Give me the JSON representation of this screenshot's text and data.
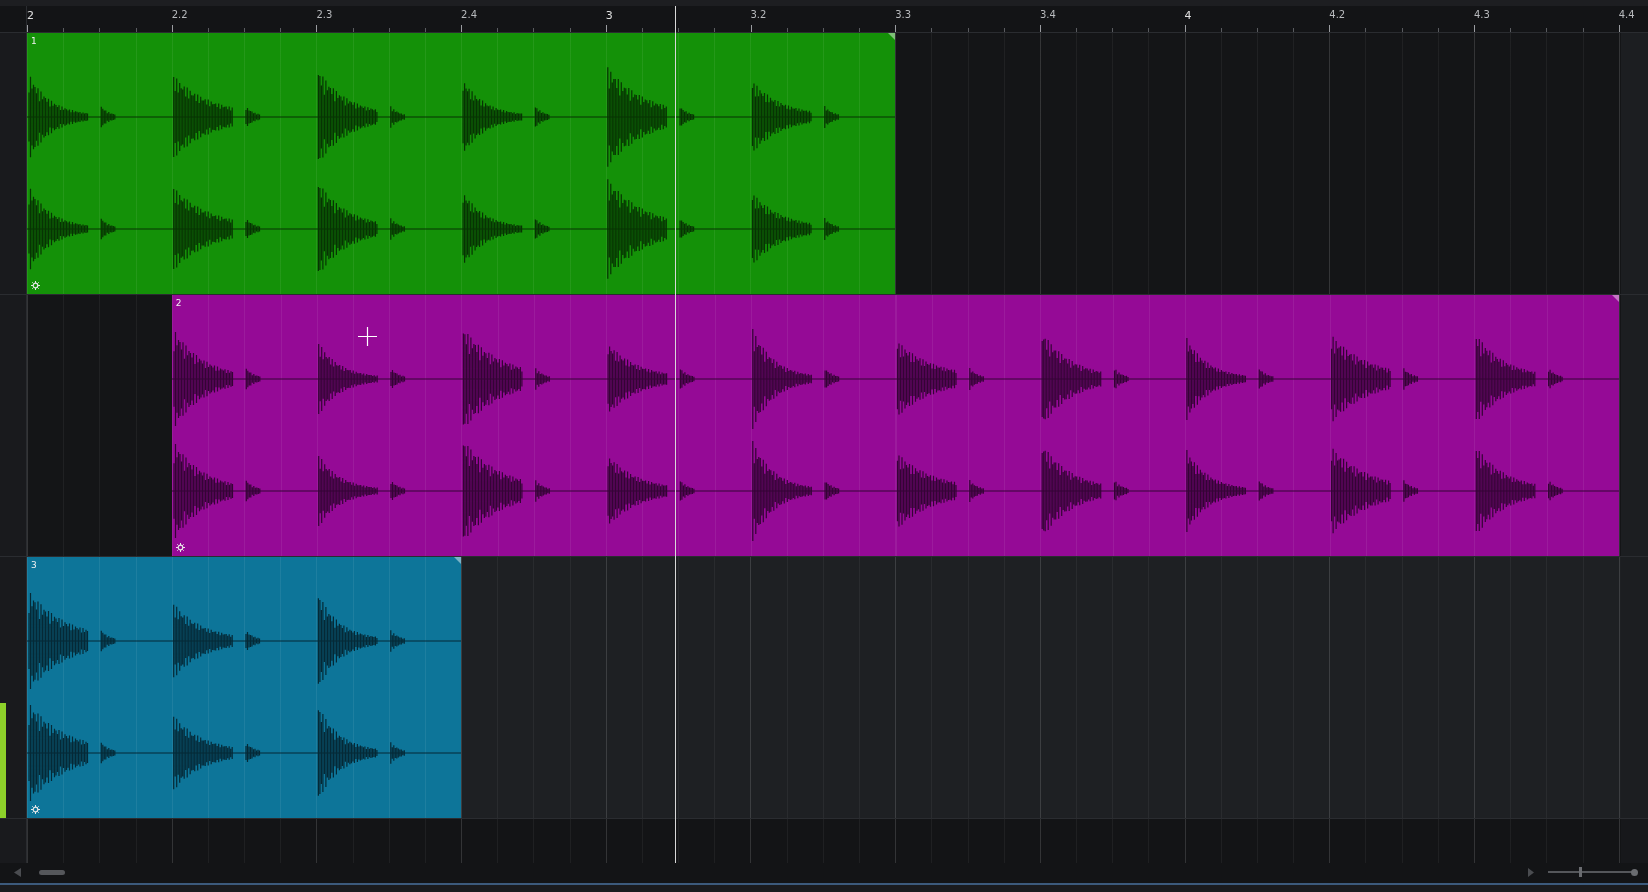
{
  "ruler": {
    "marks": [
      "2",
      "2.2",
      "2.3",
      "2.4",
      "3",
      "3.2",
      "3.3",
      "3.4",
      "4",
      "4.2",
      "4.3",
      "4.4"
    ]
  },
  "tracks": [
    {
      "selected": false,
      "level": 0,
      "clip": {
        "number": "1",
        "color": "#149108"
      }
    },
    {
      "selected": false,
      "level": 0,
      "clip": {
        "number": "2",
        "color": "#950a96"
      }
    },
    {
      "selected": true,
      "level": 0.44,
      "clip": {
        "number": "3",
        "color": "#0d7599"
      }
    }
  ],
  "zoom_slider": {
    "level": 0.36
  }
}
